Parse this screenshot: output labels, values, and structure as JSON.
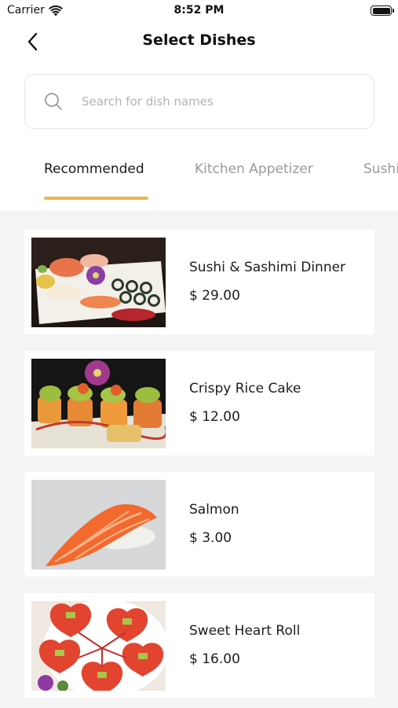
{
  "status_bar": {
    "carrier": "Carrier",
    "time": "8:52 PM"
  },
  "nav": {
    "title": "Select Dishes",
    "back_icon": "chevron-left-icon"
  },
  "search": {
    "placeholder": "Search for dish names",
    "value": "",
    "icon": "search-icon"
  },
  "tabs": [
    {
      "label": "Recommended",
      "active": true
    },
    {
      "label": "Kitchen Appetizer",
      "active": false
    },
    {
      "label": "Sushi",
      "active": false
    }
  ],
  "colors": {
    "accent": "#e8b64c",
    "list_background": "#f4f4f4"
  },
  "dishes": [
    {
      "name": "Sushi & Sashimi Dinner",
      "price": "$ 29.00"
    },
    {
      "name": "Crispy Rice Cake",
      "price": "$ 12.00"
    },
    {
      "name": "Salmon",
      "price": "$ 3.00"
    },
    {
      "name": "Sweet Heart Roll",
      "price": "$ 16.00"
    }
  ]
}
